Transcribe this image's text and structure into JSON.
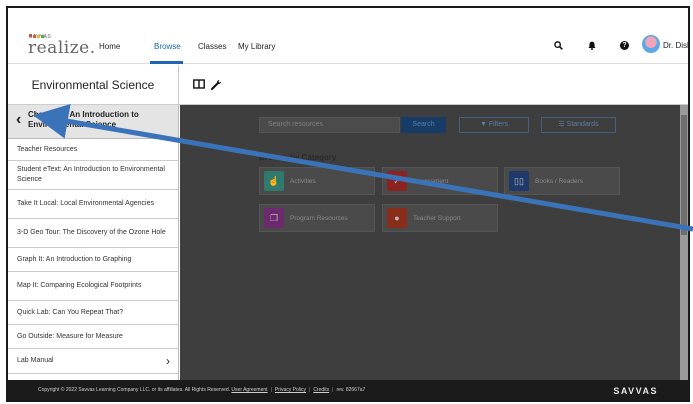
{
  "app": {
    "brand_small": "SAVVAS",
    "logo_text": "realize."
  },
  "nav": {
    "links": [
      "Home",
      "Browse",
      "Classes",
      "My Library"
    ],
    "active": "Browse",
    "user_name": "Dr. Dish"
  },
  "program": {
    "title": "Environmental Science"
  },
  "sidebar": {
    "header": "Chapter 1: An Introduction to Environmental Science",
    "items": [
      {
        "label": "Teacher Resources"
      },
      {
        "label": "Student eText: An Introduction to Environmental Science"
      },
      {
        "label": "Take It Local: Local Environmental Agencies"
      },
      {
        "label": "3-D Geo Tour: The Discovery of the Ozone Hole"
      },
      {
        "label": "Graph It: An Introduction to Graphing"
      },
      {
        "label": "Map It: Comparing Ecological Footprints"
      },
      {
        "label": "Quick Lab: Can You Repeat That?"
      },
      {
        "label": "Go Outside: Measure for Measure"
      },
      {
        "label": "Lab Manual"
      }
    ]
  },
  "main": {
    "search_placeholder": "Search resources",
    "search_button": "Search",
    "filters_button": "Filters",
    "standards_button": "Standards",
    "browse_label": "Browse by Category",
    "categories": [
      {
        "label": "Activities",
        "icon": "hand-pointer-icon",
        "color": "#2f7a6c"
      },
      {
        "label": "Assessment",
        "icon": "checklist-icon",
        "color": "#8b2323"
      },
      {
        "label": "Books / Readers",
        "icon": "open-book-icon",
        "color": "#1f3a6a"
      },
      {
        "label": "Program Resources",
        "icon": "layers-icon",
        "color": "#6b2a6e"
      },
      {
        "label": "Teacher Support",
        "icon": "apple-icon",
        "color": "#8a2d1a"
      }
    ]
  },
  "footer": {
    "copyright": "Copyright © 2022 Savvas Learning Company LLC. or its affiliates. All Rights Reserved.",
    "links": [
      "User Agreement",
      "Privacy Policy",
      "Credits"
    ],
    "revision": "rev. 82667a7",
    "brand": "SAVVAS"
  },
  "colors": {
    "accent": "#1b66b5",
    "annotation_arrow": "#3b73b9",
    "modal_overlay": "#3e3e3e",
    "footer_bg": "#1b1b1b"
  }
}
